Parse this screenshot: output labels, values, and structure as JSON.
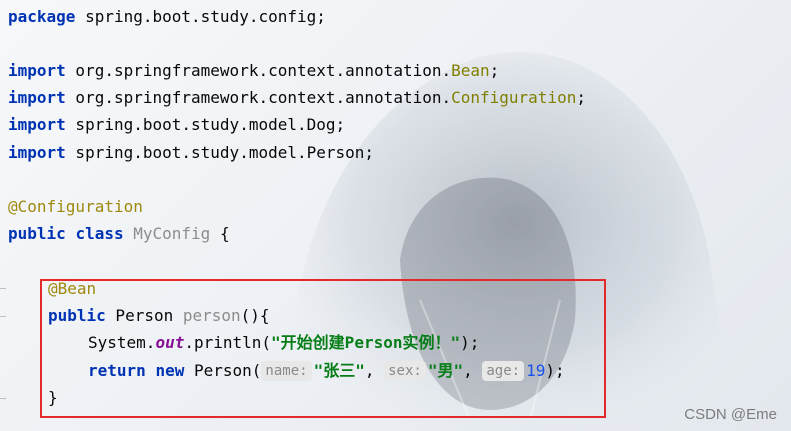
{
  "code": {
    "package_kw": "package",
    "package_name": " spring.boot.study.config;",
    "import_kw": "import",
    "import1_prefix": " org.springframework.context.annotation.",
    "import1_class": "Bean",
    "import1_suffix": ";",
    "import2_prefix": " org.springframework.context.annotation.",
    "import2_class": "Configuration",
    "import2_suffix": ";",
    "import3_rest": " spring.boot.study.model.Dog;",
    "import4_rest": " spring.boot.study.model.Person;",
    "class_annotation": "@Configuration",
    "public_kw": "public",
    "class_kw": "class",
    "class_name": "MyConfig",
    "open_brace": " {",
    "bean_annotation": "@Bean",
    "method_return_type": " Person ",
    "method_name": "person",
    "method_sig_end": "(){",
    "println_prefix": "System.",
    "println_field": "out",
    "println_method": ".println(",
    "println_string": "\"开始创建Person实例！\"",
    "println_end": ");",
    "return_kw": "return",
    "new_kw": "new",
    "ctor_call": " Person(",
    "hint_name": "name:",
    "arg_name": "\"张三\"",
    "comma1": ", ",
    "hint_sex": "sex:",
    "arg_sex": "\"男\"",
    "comma2": ", ",
    "hint_age": "age:",
    "arg_age": "19",
    "ctor_end": ");",
    "close_brace": "}"
  },
  "watermark": "CSDN @Eme",
  "colors": {
    "keyword": "#0033b3",
    "annotation": "#9e880d",
    "string": "#067d17",
    "number": "#1750eb",
    "highlight_border": "#e32a2a"
  }
}
